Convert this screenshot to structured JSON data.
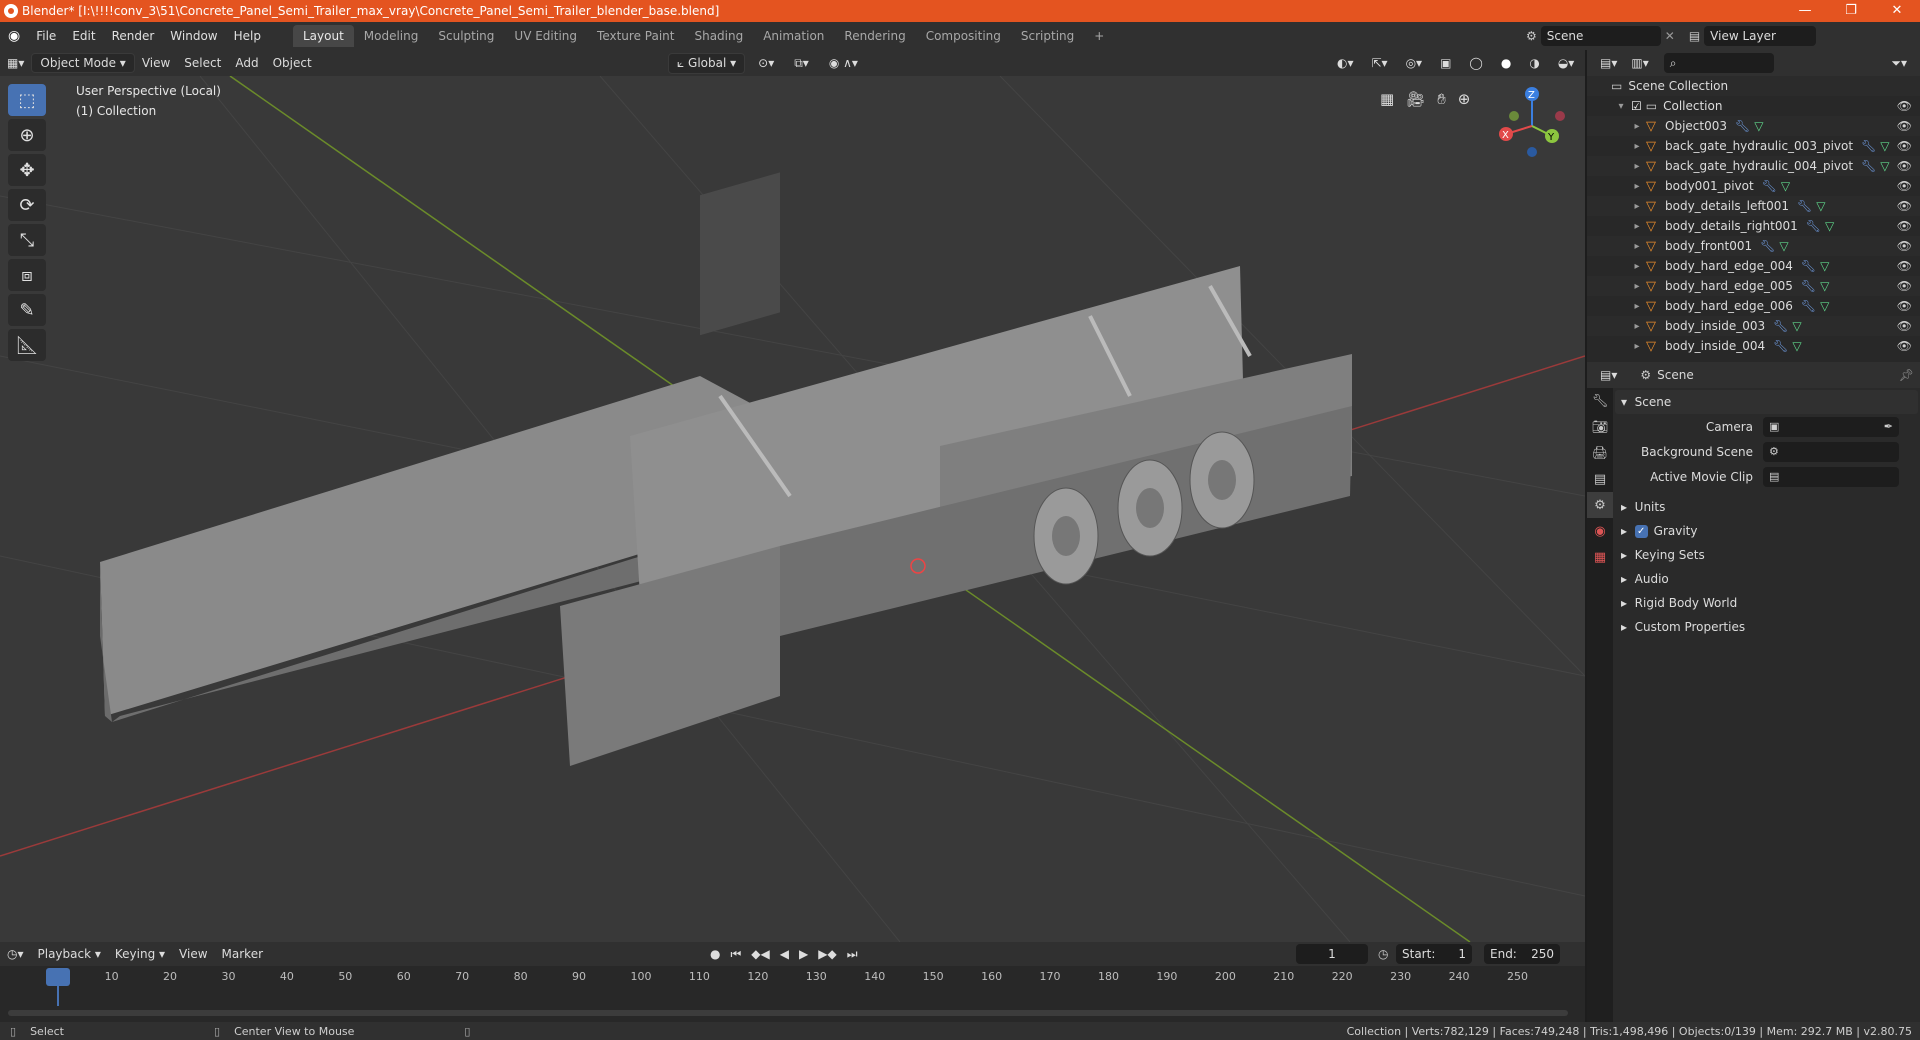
{
  "window": {
    "title": "Blender* [I:\\!!!!conv_3\\51\\Concrete_Panel_Semi_Trailer_max_vray\\Concrete_Panel_Semi_Trailer_blender_base.blend]",
    "minimize": "—",
    "maximize": "❐",
    "close": "✕"
  },
  "menu": [
    "File",
    "Edit",
    "Render",
    "Window",
    "Help"
  ],
  "workspaces": [
    "Layout",
    "Modeling",
    "Sculpting",
    "UV Editing",
    "Texture Paint",
    "Shading",
    "Animation",
    "Rendering",
    "Compositing",
    "Scripting"
  ],
  "active_workspace": "Layout",
  "add_workspace": "+",
  "scene_field": "Scene",
  "view_layer_field": "View Layer",
  "viewport": {
    "mode": "Object Mode",
    "menus": [
      "View",
      "Select",
      "Add",
      "Object"
    ],
    "orientation": "Global",
    "perspective_label": "User Perspective (Local)",
    "collection_label": "(1) Collection",
    "gizmo": {
      "x": "X",
      "y": "Y",
      "z": "Z"
    }
  },
  "outliner": {
    "root": "Scene Collection",
    "collection": "Collection",
    "items": [
      "Object003",
      "back_gate_hydraulic_003_pivot",
      "back_gate_hydraulic_004_pivot",
      "body001_pivot",
      "body_details_left001",
      "body_details_right001",
      "body_front001",
      "body_hard_edge_004",
      "body_hard_edge_005",
      "body_hard_edge_006",
      "body_inside_003",
      "body_inside_004"
    ]
  },
  "properties": {
    "header": "Scene",
    "section": "Scene",
    "fields": [
      {
        "label": "Camera",
        "value": ""
      },
      {
        "label": "Background Scene",
        "value": ""
      },
      {
        "label": "Active Movie Clip",
        "value": ""
      }
    ],
    "subpanels": [
      "Units",
      "Gravity",
      "Keying Sets",
      "Audio",
      "Rigid Body World",
      "Custom Properties"
    ],
    "gravity_checked": true
  },
  "timeline": {
    "menus": [
      "Playback",
      "Keying",
      "View",
      "Marker"
    ],
    "current_frame": "1",
    "start_label": "Start:",
    "start": "1",
    "end_label": "End:",
    "end": "250",
    "ticks": [
      "1",
      "10",
      "20",
      "30",
      "40",
      "50",
      "60",
      "70",
      "80",
      "90",
      "100",
      "110",
      "120",
      "130",
      "140",
      "150",
      "160",
      "170",
      "180",
      "190",
      "200",
      "210",
      "220",
      "230",
      "240",
      "250"
    ]
  },
  "statusbar": {
    "left_action": "Select",
    "middle_action": "Center View to Mouse",
    "stats": "Collection | Verts:782,129 | Faces:749,248 | Tris:1,498,496 | Objects:0/139 | Mem: 292.7 MB | v2.80.75"
  },
  "colors": {
    "title_bar": "#e45420",
    "accent": "#4772b3",
    "mesh_icon": "#e88c2c",
    "axis_x": "#e24a4a",
    "axis_y": "#8cc63f",
    "axis_z": "#3b7fe0"
  }
}
